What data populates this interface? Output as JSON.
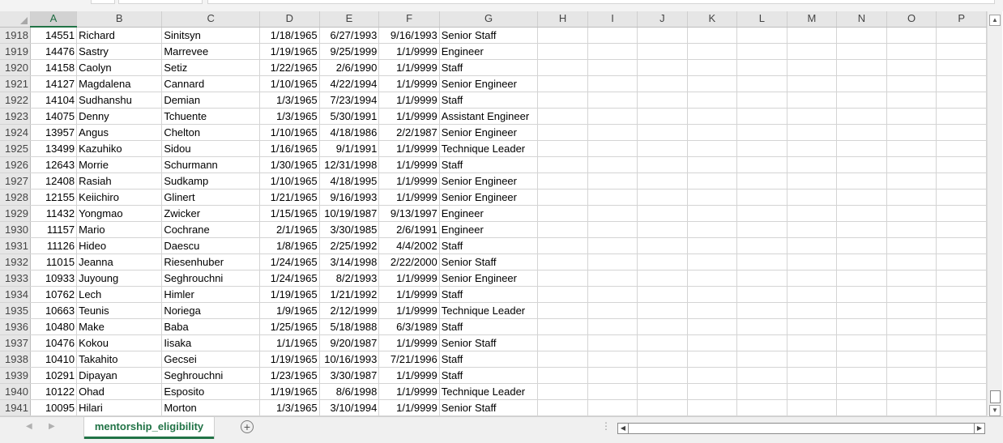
{
  "columns": [
    "A",
    "B",
    "C",
    "D",
    "E",
    "F",
    "G",
    "H",
    "I",
    "J",
    "K",
    "L",
    "M",
    "N",
    "O",
    "P"
  ],
  "rows": [
    {
      "row": "1918",
      "a": "14551",
      "b": "Richard",
      "c": "Sinitsyn",
      "d": "1/18/1965",
      "e": "6/27/1993",
      "f": "9/16/1993",
      "g": "Senior Staff"
    },
    {
      "row": "1919",
      "a": "14476",
      "b": "Sastry",
      "c": "Marrevee",
      "d": "1/19/1965",
      "e": "9/25/1999",
      "f": "1/1/9999",
      "g": "Engineer"
    },
    {
      "row": "1920",
      "a": "14158",
      "b": "Caolyn",
      "c": "Setiz",
      "d": "1/22/1965",
      "e": "2/6/1990",
      "f": "1/1/9999",
      "g": "Staff"
    },
    {
      "row": "1921",
      "a": "14127",
      "b": "Magdalena",
      "c": "Cannard",
      "d": "1/10/1965",
      "e": "4/22/1994",
      "f": "1/1/9999",
      "g": "Senior Engineer"
    },
    {
      "row": "1922",
      "a": "14104",
      "b": "Sudhanshu",
      "c": "Demian",
      "d": "1/3/1965",
      "e": "7/23/1994",
      "f": "1/1/9999",
      "g": "Staff"
    },
    {
      "row": "1923",
      "a": "14075",
      "b": "Denny",
      "c": "Tchuente",
      "d": "1/3/1965",
      "e": "5/30/1991",
      "f": "1/1/9999",
      "g": "Assistant Engineer"
    },
    {
      "row": "1924",
      "a": "13957",
      "b": "Angus",
      "c": "Chelton",
      "d": "1/10/1965",
      "e": "4/18/1986",
      "f": "2/2/1987",
      "g": "Senior Engineer"
    },
    {
      "row": "1925",
      "a": "13499",
      "b": "Kazuhiko",
      "c": "Sidou",
      "d": "1/16/1965",
      "e": "9/1/1991",
      "f": "1/1/9999",
      "g": "Technique Leader"
    },
    {
      "row": "1926",
      "a": "12643",
      "b": "Morrie",
      "c": "Schurmann",
      "d": "1/30/1965",
      "e": "12/31/1998",
      "f": "1/1/9999",
      "g": "Staff"
    },
    {
      "row": "1927",
      "a": "12408",
      "b": "Rasiah",
      "c": "Sudkamp",
      "d": "1/10/1965",
      "e": "4/18/1995",
      "f": "1/1/9999",
      "g": "Senior Engineer"
    },
    {
      "row": "1928",
      "a": "12155",
      "b": "Keiichiro",
      "c": "Glinert",
      "d": "1/21/1965",
      "e": "9/16/1993",
      "f": "1/1/9999",
      "g": "Senior Engineer"
    },
    {
      "row": "1929",
      "a": "11432",
      "b": "Yongmao",
      "c": "Zwicker",
      "d": "1/15/1965",
      "e": "10/19/1987",
      "f": "9/13/1997",
      "g": "Engineer"
    },
    {
      "row": "1930",
      "a": "11157",
      "b": "Mario",
      "c": "Cochrane",
      "d": "2/1/1965",
      "e": "3/30/1985",
      "f": "2/6/1991",
      "g": "Engineer"
    },
    {
      "row": "1931",
      "a": "11126",
      "b": "Hideo",
      "c": "Daescu",
      "d": "1/8/1965",
      "e": "2/25/1992",
      "f": "4/4/2002",
      "g": "Staff"
    },
    {
      "row": "1932",
      "a": "11015",
      "b": "Jeanna",
      "c": "Riesenhuber",
      "d": "1/24/1965",
      "e": "3/14/1998",
      "f": "2/22/2000",
      "g": "Senior Staff"
    },
    {
      "row": "1933",
      "a": "10933",
      "b": "Juyoung",
      "c": "Seghrouchni",
      "d": "1/24/1965",
      "e": "8/2/1993",
      "f": "1/1/9999",
      "g": "Senior Engineer"
    },
    {
      "row": "1934",
      "a": "10762",
      "b": "Lech",
      "c": "Himler",
      "d": "1/19/1965",
      "e": "1/21/1992",
      "f": "1/1/9999",
      "g": "Staff"
    },
    {
      "row": "1935",
      "a": "10663",
      "b": "Teunis",
      "c": "Noriega",
      "d": "1/9/1965",
      "e": "2/12/1999",
      "f": "1/1/9999",
      "g": "Technique Leader"
    },
    {
      "row": "1936",
      "a": "10480",
      "b": "Make",
      "c": "Baba",
      "d": "1/25/1965",
      "e": "5/18/1988",
      "f": "6/3/1989",
      "g": "Staff"
    },
    {
      "row": "1937",
      "a": "10476",
      "b": "Kokou",
      "c": "Iisaka",
      "d": "1/1/1965",
      "e": "9/20/1987",
      "f": "1/1/9999",
      "g": "Senior Staff"
    },
    {
      "row": "1938",
      "a": "10410",
      "b": "Takahito",
      "c": "Gecsei",
      "d": "1/19/1965",
      "e": "10/16/1993",
      "f": "7/21/1996",
      "g": "Staff"
    },
    {
      "row": "1939",
      "a": "10291",
      "b": "Dipayan",
      "c": "Seghrouchni",
      "d": "1/23/1965",
      "e": "3/30/1987",
      "f": "1/1/9999",
      "g": "Staff"
    },
    {
      "row": "1940",
      "a": "10122",
      "b": "Ohad",
      "c": "Esposito",
      "d": "1/19/1965",
      "e": "8/6/1998",
      "f": "1/1/9999",
      "g": "Technique Leader"
    },
    {
      "row": "1941",
      "a": "10095",
      "b": "Hilari",
      "c": "Morton",
      "d": "1/3/1965",
      "e": "3/10/1994",
      "f": "1/1/9999",
      "g": "Senior Staff"
    }
  ],
  "sheet_tab": "mentorship_eligibility",
  "add_sheet_glyph": "+",
  "icons": {
    "add_sheet": "plus-circle-icon",
    "scroll_up": "triangle-up-icon",
    "scroll_down": "triangle-down-icon",
    "scroll_left": "triangle-left-icon",
    "scroll_right": "triangle-right-icon"
  },
  "colors": {
    "accent": "#217346",
    "header_bg": "#e6e6e6",
    "gridline": "#d4d4d4"
  }
}
